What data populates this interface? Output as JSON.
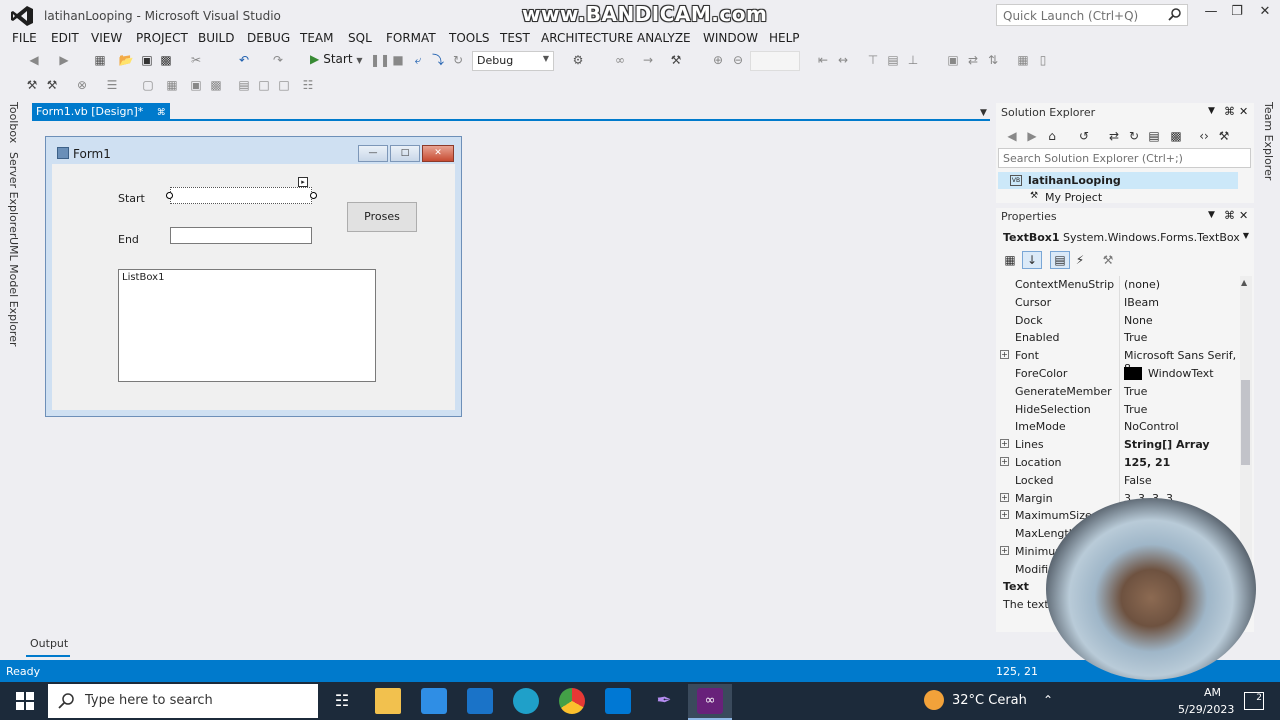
{
  "window": {
    "title": "latihanLooping - Microsoft Visual Studio",
    "watermark": "www.BANDICAM.com",
    "quick_launch_placeholder": "Quick Launch (Ctrl+Q)"
  },
  "menu": [
    "FILE",
    "EDIT",
    "VIEW",
    "PROJECT",
    "BUILD",
    "DEBUG",
    "TEAM",
    "SQL",
    "FORMAT",
    "TOOLS",
    "TEST",
    "ARCHITECTURE",
    "ANALYZE",
    "WINDOW",
    "HELP"
  ],
  "toolbar": {
    "start_label": "Start",
    "config": "Debug"
  },
  "side_tabs": [
    "Toolbox",
    "Server Explorer",
    "UML Model Explorer"
  ],
  "right_side_tab": "Team Explorer",
  "document": {
    "tab_label": "Form1.vb [Design]*",
    "form": {
      "title": "Form1",
      "start_label": "Start",
      "end_label": "End",
      "button_label": "Proses",
      "listbox_label": "ListBox1"
    }
  },
  "solution_explorer": {
    "title": "Solution Explorer",
    "search_placeholder": "Search Solution Explorer (Ctrl+;)",
    "project": "latihanLooping",
    "item": "My Project"
  },
  "properties": {
    "title": "Properties",
    "object_name": "TextBox1",
    "object_type": "System.Windows.Forms.TextBox",
    "rows": [
      {
        "name": "ContextMenuStrip",
        "value": "(none)",
        "expandable": false,
        "bold": false
      },
      {
        "name": "Cursor",
        "value": "IBeam",
        "expandable": false,
        "bold": false
      },
      {
        "name": "Dock",
        "value": "None",
        "expandable": false,
        "bold": false
      },
      {
        "name": "Enabled",
        "value": "True",
        "expandable": false,
        "bold": false
      },
      {
        "name": "Font",
        "value": "Microsoft Sans Serif, 8.",
        "expandable": true,
        "bold": false
      },
      {
        "name": "ForeColor",
        "value": "WindowText",
        "expandable": false,
        "bold": false,
        "swatch": "#000000"
      },
      {
        "name": "GenerateMember",
        "value": "True",
        "expandable": false,
        "bold": false
      },
      {
        "name": "HideSelection",
        "value": "True",
        "expandable": false,
        "bold": false
      },
      {
        "name": "ImeMode",
        "value": "NoControl",
        "expandable": false,
        "bold": false
      },
      {
        "name": "Lines",
        "value": "String[] Array",
        "expandable": true,
        "bold": true
      },
      {
        "name": "Location",
        "value": "125, 21",
        "expandable": true,
        "bold": true
      },
      {
        "name": "Locked",
        "value": "False",
        "expandable": false,
        "bold": false
      },
      {
        "name": "Margin",
        "value": "3, 3, 3, 3",
        "expandable": true,
        "bold": false
      },
      {
        "name": "MaximumSize",
        "value": "",
        "expandable": true,
        "bold": false
      },
      {
        "name": "MaxLength",
        "value": "",
        "expandable": false,
        "bold": false
      },
      {
        "name": "Minimum",
        "value": "",
        "expandable": true,
        "bold": false
      },
      {
        "name": "Modifie",
        "value": "",
        "expandable": false,
        "bold": false
      }
    ],
    "desc_title": "Text",
    "desc_text": "The text"
  },
  "output_tab": "Output",
  "status": {
    "left": "Ready",
    "position": "125, 21"
  },
  "taskbar": {
    "search_placeholder": "Type here to search",
    "weather": "32°C  Cerah",
    "time": "AM",
    "date": "5/29/2023",
    "notif_count": "2"
  },
  "colors": {
    "accent": "#007acc",
    "vs_purple": "#68217a",
    "taskbar": "#1c2a3a"
  }
}
